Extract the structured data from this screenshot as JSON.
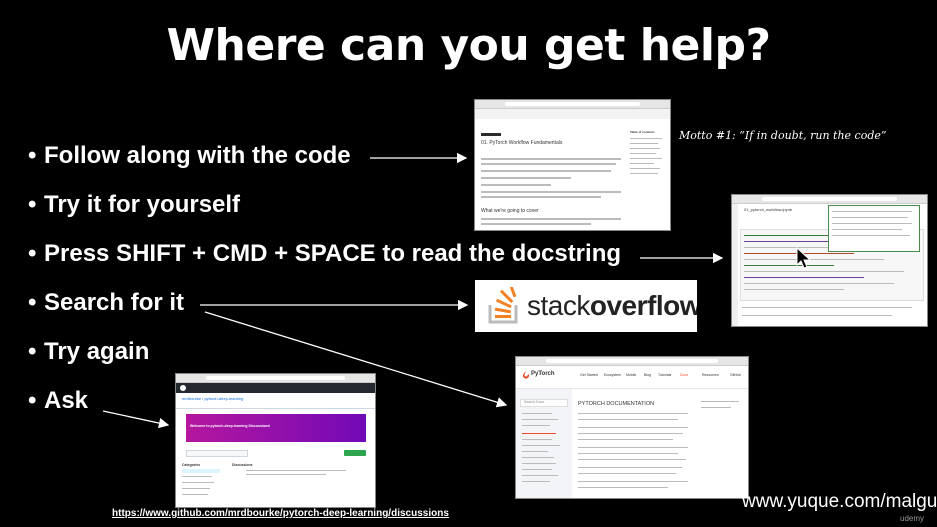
{
  "slide": {
    "title": "Where can you get help?",
    "bullets": [
      "Follow along with the code",
      "Try it for yourself",
      "Press SHIFT + CMD + SPACE to read the docstring",
      "Search for it",
      "Try again",
      "Ask"
    ],
    "bullet_glyph": "•",
    "motto": "Motto #1: “If in doubt, run the code”",
    "discussions_url": "https://www.github.com/mrdbourke/pytorch-deep-learning/discussions",
    "watermark": "www.yuque.com/malguy",
    "udemy": "udemy"
  },
  "screens": {
    "workflow_docs": {
      "heading": "01. PyTorch Workflow Fundamentals",
      "subheading": "What we're going to cover",
      "toc_title": "Table of contents"
    },
    "colab": {
      "notebook_name": "01_pytorch_workflow.ipynb"
    },
    "stackoverflow": {
      "word_stack": "stack",
      "word_overflow": "overflow"
    },
    "github": {
      "repo": "mrdbourke / pytorch-deep-learning",
      "banner": "Welcome to pytorch-deep-learning Discussions!",
      "categories_label": "Categories",
      "discussions_label": "Discussions"
    },
    "pytorch_docs": {
      "logo_text": "PyTorch",
      "heading": "PYTORCH DOCUMENTATION",
      "search_placeholder": "Search Docs",
      "nav": [
        "Get Started",
        "Ecosystem",
        "Mobile",
        "Blog",
        "Tutorials",
        "Docs",
        "Resources",
        "GitHub"
      ]
    }
  },
  "colors": {
    "background": "#000000",
    "text": "#ffffff",
    "stackoverflow_orange": "#f48024",
    "github_banner": "#c02fb3",
    "pytorch_orange": "#ee4c2c"
  }
}
